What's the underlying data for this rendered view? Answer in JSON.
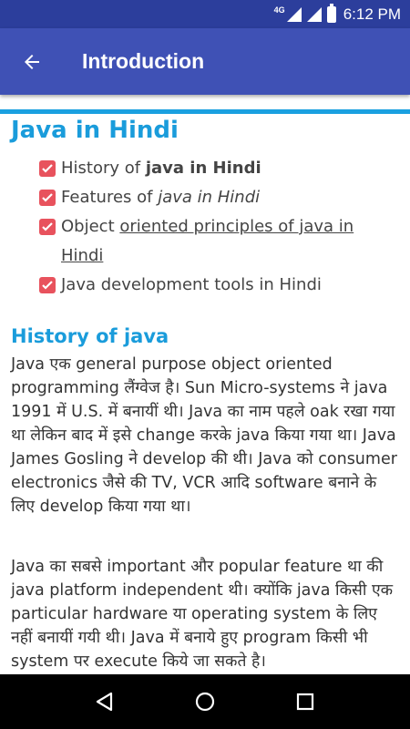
{
  "status_bar": {
    "network": "4G",
    "time": "6:12 PM"
  },
  "app_bar": {
    "title": "Introduction",
    "back_icon": "arrow-back-icon"
  },
  "page_title": "Java in Hindi",
  "toc": {
    "check_icon": "checkbox-checked-icon",
    "accent_color": "#e8525d",
    "items": [
      {
        "prefix": "History of ",
        "emph": "java in Hindi"
      },
      {
        "prefix": "Features of ",
        "emph": "java in Hindi"
      },
      {
        "prefix": "Object ",
        "emph": "oriented principles of java in Hindi "
      },
      {
        "prefix": "Java development tools in Hindi",
        "emph": ""
      }
    ]
  },
  "section": {
    "heading": "History of java",
    "paragraphs": [
      "Java एक general purpose object oriented programming लैंग्वेज है। Sun Micro-systems ने java 1991 में U.S. में बनायीं थी। Java का नाम पहले oak रखा गया था लेकिन बाद में इसे change करके java किया गया था। Java James Gosling ने develop की थी। Java को consumer electronics जैसे की TV, VCR आदि software बनाने के लिए develop किया गया था।",
      "Java का सबसे important और popular feature था की java platform independent थी। क्योंकि java किसी एक particular hardware या operating system के लिए नहीं बनायीं गयी थी। Java में बनाये हुए program किसी भी system पर execute किये जा सकते है।"
    ]
  },
  "colors": {
    "status_bar": "#2c3e9c",
    "app_bar": "#3f51b5",
    "heading": "#1a9cdb"
  },
  "nav_bar": {
    "back_icon": "nav-back-icon",
    "home_icon": "nav-home-icon",
    "recents_icon": "nav-recents-icon"
  }
}
